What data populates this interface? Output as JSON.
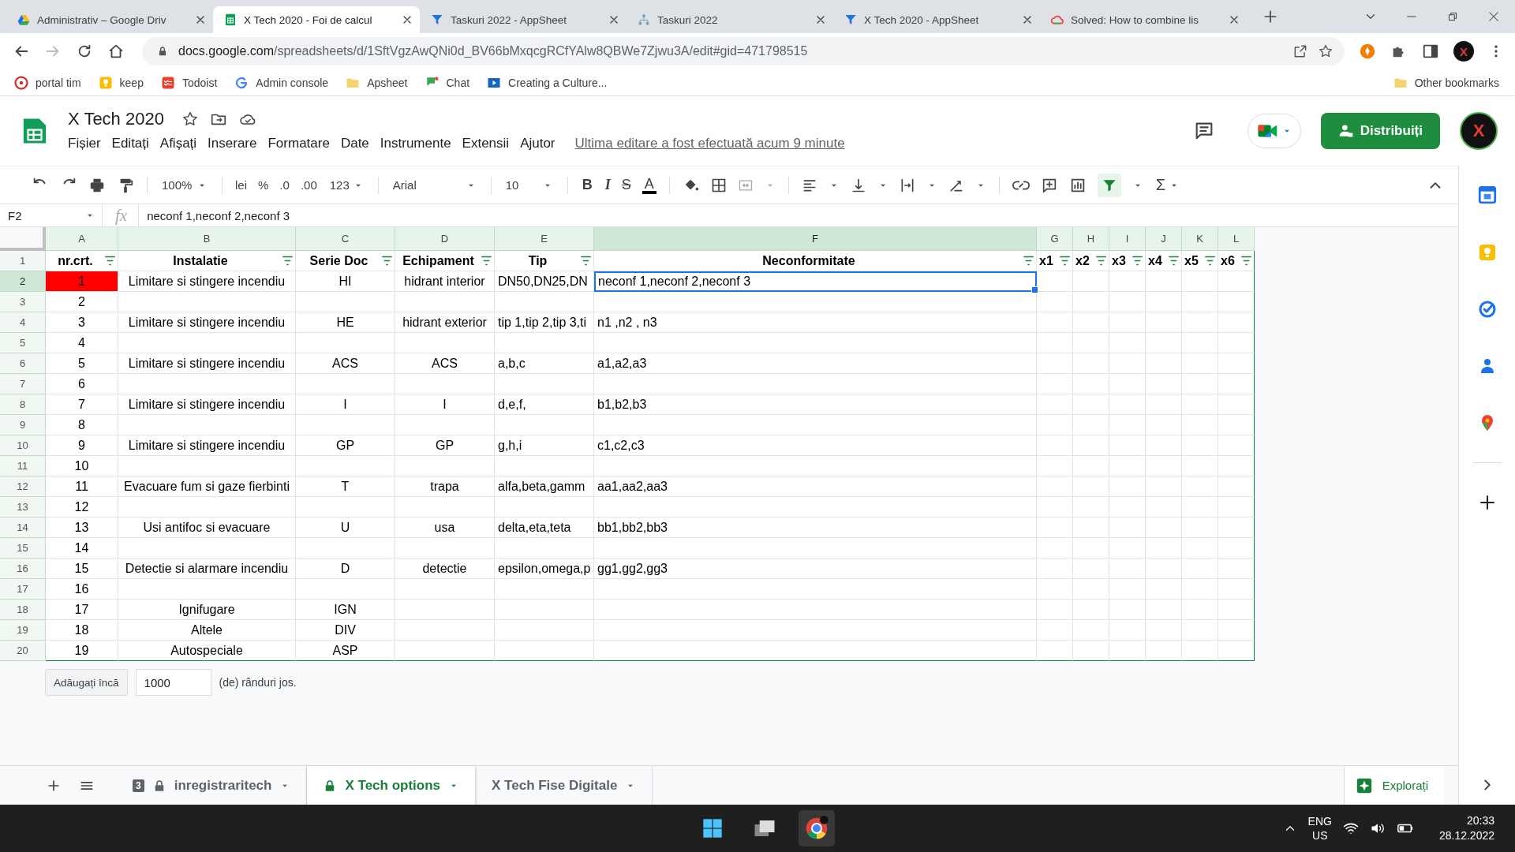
{
  "browser": {
    "tabs": [
      {
        "title": "Administrativ – Google Driv",
        "selected": false
      },
      {
        "title": "X Tech 2020 - Foi de calcul",
        "selected": true
      },
      {
        "title": "Taskuri 2022 - AppSheet",
        "selected": false
      },
      {
        "title": "Taskuri 2022",
        "selected": false
      },
      {
        "title": "X Tech 2020 - AppSheet",
        "selected": false
      },
      {
        "title": "Solved: How to combine lis",
        "selected": false
      }
    ],
    "address": {
      "host": "docs.google.com",
      "path": "/spreadsheets/d/1SftVgzAwQNi0d_BV66bMxqcgRCfYAlw8QBWe7Zjwu3A/edit#gid=471798515"
    },
    "profile": "X",
    "bookmarks": [
      {
        "label": "portal tim"
      },
      {
        "label": "keep"
      },
      {
        "label": "Todoist"
      },
      {
        "label": "Admin console"
      },
      {
        "label": "Apsheet"
      },
      {
        "label": "Chat"
      },
      {
        "label": "Creating a Culture..."
      }
    ],
    "other_bookmarks": "Other bookmarks"
  },
  "sheets": {
    "doc_title": "X Tech 2020",
    "menu": [
      "Fișier",
      "Editați",
      "Afișați",
      "Inserare",
      "Formatare",
      "Date",
      "Instrumente",
      "Extensii",
      "Ajutor"
    ],
    "last_edit": "Ultima editare a fost efectuată acum 9 minute",
    "share_button": "Distribuiți",
    "avatar": "X",
    "toolbar": {
      "zoom": "100%",
      "currency": "lei",
      "percent": "%",
      "decrease_decimals": ".0",
      "increase_decimals": ".00",
      "number_format": "123",
      "font": "Arial",
      "font_size": "10",
      "bold": "B",
      "italic": "I",
      "strikethrough": "S",
      "text_color": "A",
      "functions": "Σ",
      "filter_on": true
    },
    "formula_bar": {
      "cell_ref": "F2",
      "fx": "fx",
      "value": "neconf 1,neconf 2,neconf 3"
    },
    "grid": {
      "columns": [
        {
          "letter": "A",
          "selected": false
        },
        {
          "letter": "B",
          "selected": false
        },
        {
          "letter": "C",
          "selected": false
        },
        {
          "letter": "D",
          "selected": false
        },
        {
          "letter": "E",
          "selected": false
        },
        {
          "letter": "F",
          "selected": true
        },
        {
          "letter": "G",
          "selected": false
        },
        {
          "letter": "H",
          "selected": false
        },
        {
          "letter": "I",
          "selected": false
        },
        {
          "letter": "J",
          "selected": false
        },
        {
          "letter": "K",
          "selected": false
        },
        {
          "letter": "L",
          "selected": false
        }
      ],
      "header_row": {
        "number": "1",
        "cells": {
          "a": "nr.crt.",
          "b": "Instalatie",
          "c": "Serie Doc",
          "d": "Echipament",
          "e": "Tip",
          "f": "Neconformitate",
          "g": "x1",
          "h": "x2",
          "i": "x3",
          "j": "x4",
          "k": "x5",
          "l": "x6"
        }
      },
      "rows": [
        {
          "number": "2",
          "selected": true,
          "cells": {
            "a": {
              "text": "1",
              "color": "#ff0000"
            },
            "b": "Limitare si stingere incendiu",
            "c": "HI",
            "d": "hidrant interior",
            "e": "DN50,DN25,DN",
            "f": {
              "text": "neconf 1,neconf 2,neconf 3",
              "active": true
            }
          }
        },
        {
          "number": "3",
          "selected": false,
          "cells": {
            "a": "2"
          }
        },
        {
          "number": "4",
          "selected": false,
          "cells": {
            "a": "3",
            "b": "Limitare si stingere incendiu",
            "c": "HE",
            "d": "hidrant exterior",
            "e": "tip 1,tip 2,tip 3,ti",
            "f": "n1 ,n2 , n3"
          }
        },
        {
          "number": "5",
          "selected": false,
          "cells": {
            "a": "4"
          }
        },
        {
          "number": "6",
          "selected": false,
          "cells": {
            "a": "5",
            "b": "Limitare si stingere incendiu",
            "c": "ACS",
            "d": "ACS",
            "e": "a,b,c",
            "f": "a1,a2,a3"
          }
        },
        {
          "number": "7",
          "selected": false,
          "cells": {
            "a": "6"
          }
        },
        {
          "number": "8",
          "selected": false,
          "cells": {
            "a": "7",
            "b": "Limitare si stingere incendiu",
            "c": "I",
            "d": "I",
            "e": "d,e,f,",
            "f": "b1,b2,b3"
          }
        },
        {
          "number": "9",
          "selected": false,
          "cells": {
            "a": "8"
          }
        },
        {
          "number": "10",
          "selected": false,
          "cells": {
            "a": "9",
            "b": "Limitare si stingere incendiu",
            "c": "GP",
            "d": "GP",
            "e": "g,h,i",
            "f": "c1,c2,c3"
          }
        },
        {
          "number": "11",
          "selected": false,
          "cells": {
            "a": "10"
          }
        },
        {
          "number": "12",
          "selected": false,
          "cells": {
            "a": "11",
            "b": "Evacuare fum si gaze fierbinti",
            "c": "T",
            "d": "trapa",
            "e": "alfa,beta,gamm",
            "f": "aa1,aa2,aa3"
          }
        },
        {
          "number": "13",
          "selected": false,
          "cells": {
            "a": "12"
          }
        },
        {
          "number": "14",
          "selected": false,
          "cells": {
            "a": "13",
            "b": "Usi antifoc si evacuare",
            "c": "U",
            "d": "usa",
            "e": "delta,eta,teta",
            "f": "bb1,bb2,bb3"
          }
        },
        {
          "number": "15",
          "selected": false,
          "cells": {
            "a": "14"
          }
        },
        {
          "number": "16",
          "selected": false,
          "cells": {
            "a": "15",
            "b": "Detectie si alarmare incendiu",
            "c": "D",
            "d": "detectie",
            "e": "epsilon,omega,p",
            "f": "gg1,gg2,gg3"
          }
        },
        {
          "number": "17",
          "selected": false,
          "cells": {
            "a": "16"
          }
        },
        {
          "number": "18",
          "selected": false,
          "cells": {
            "a": "17",
            "b": "Ignifugare",
            "c": "IGN"
          }
        },
        {
          "number": "19",
          "selected": false,
          "cells": {
            "a": "18",
            "b": "Altele",
            "c": "DIV"
          }
        },
        {
          "number": "20",
          "selected": false,
          "cells": {
            "a": "19",
            "b": "Autospeciale",
            "c": "ASP"
          }
        }
      ]
    },
    "add_rows": {
      "button": "Adăugați încă",
      "value": "1000",
      "suffix": "(de) rânduri jos."
    },
    "sheet_tabs": [
      {
        "label": "inregistraritech",
        "badge": "3",
        "locked": true,
        "selected": false
      },
      {
        "label": "X Tech options",
        "locked": true,
        "selected": true
      },
      {
        "label": "X Tech Fise Digitale",
        "locked": false,
        "selected": false
      }
    ],
    "explore_button": "Explorați"
  },
  "taskbar": {
    "language": "ENG",
    "region": "US",
    "time": "20:33",
    "date": "28.12.2022"
  }
}
